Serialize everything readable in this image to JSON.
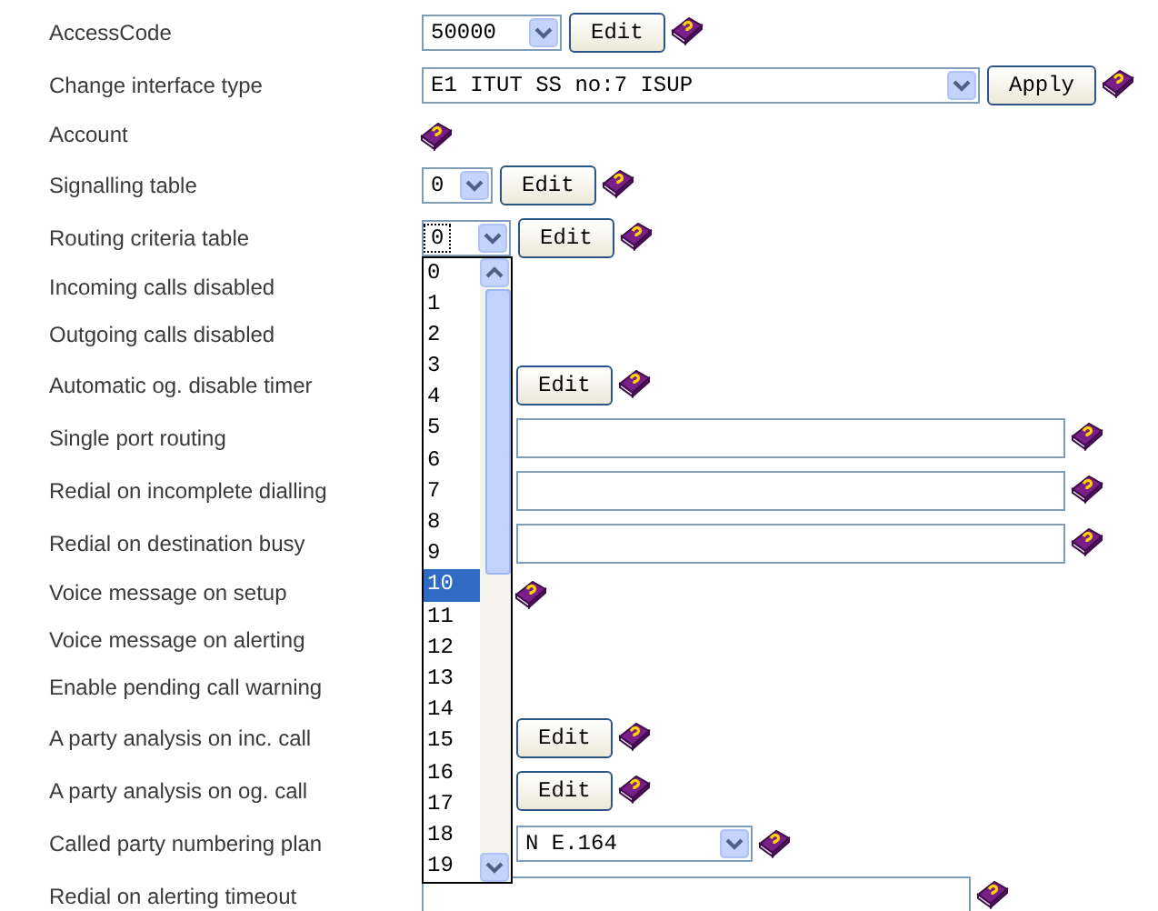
{
  "rows": [
    {
      "label": "AccessCode",
      "controls": [
        {
          "kind": "select",
          "value": "50000",
          "focused": false
        },
        {
          "kind": "button",
          "label": "Edit"
        },
        {
          "kind": "help"
        }
      ]
    },
    {
      "label": "Change interface type",
      "controls": [
        {
          "kind": "select",
          "value": "E1 ITUT SS no:7 ISUP",
          "focused": false
        },
        {
          "kind": "button",
          "label": "Apply"
        },
        {
          "kind": "help"
        }
      ]
    },
    {
      "label": "Account",
      "controls": [
        {
          "kind": "help"
        }
      ]
    },
    {
      "label": "Signalling table",
      "controls": [
        {
          "kind": "select",
          "value": "0",
          "focused": false
        },
        {
          "kind": "button",
          "label": "Edit"
        },
        {
          "kind": "help"
        }
      ]
    },
    {
      "label": "Routing criteria table",
      "controls": [
        {
          "kind": "select",
          "value": "0",
          "focused": true
        },
        {
          "kind": "button",
          "label": "Edit"
        },
        {
          "kind": "help"
        }
      ]
    },
    {
      "label": "Incoming calls disabled",
      "controls": []
    },
    {
      "label": "Outgoing calls disabled",
      "controls": []
    },
    {
      "label": "Automatic og. disable timer",
      "controls": [
        {
          "kind": "button",
          "label": "Edit"
        },
        {
          "kind": "help"
        }
      ]
    },
    {
      "label": "Single port routing",
      "controls": [
        {
          "kind": "input"
        },
        {
          "kind": "help"
        }
      ]
    },
    {
      "label": "Redial on incomplete dialling",
      "controls": [
        {
          "kind": "input"
        },
        {
          "kind": "help"
        }
      ]
    },
    {
      "label": "Redial on destination busy",
      "controls": [
        {
          "kind": "input"
        },
        {
          "kind": "help"
        }
      ]
    },
    {
      "label": "Voice message on setup",
      "controls": [
        {
          "kind": "help"
        }
      ]
    },
    {
      "label": "Voice message on alerting",
      "controls": []
    },
    {
      "label": "Enable pending call warning",
      "controls": []
    },
    {
      "label": "A party analysis on inc. call",
      "controls": [
        {
          "kind": "button",
          "label": "Edit"
        },
        {
          "kind": "help"
        }
      ]
    },
    {
      "label": "A party analysis on og. call",
      "controls": [
        {
          "kind": "button",
          "label": "Edit"
        },
        {
          "kind": "help"
        }
      ]
    },
    {
      "label": "Called party numbering plan",
      "controls": [
        {
          "kind": "select",
          "value": "N E.164",
          "focused": false
        },
        {
          "kind": "help"
        }
      ]
    },
    {
      "label": "Redial on alerting timeout",
      "controls": [
        {
          "kind": "input"
        },
        {
          "kind": "help"
        }
      ]
    }
  ],
  "dropdown": {
    "options": [
      {
        "label": "0",
        "selected": false
      },
      {
        "label": "1",
        "selected": false
      },
      {
        "label": "2",
        "selected": false
      },
      {
        "label": "3",
        "selected": false
      },
      {
        "label": "4",
        "selected": false
      },
      {
        "label": "5",
        "selected": false
      },
      {
        "label": "6",
        "selected": false
      },
      {
        "label": "7",
        "selected": false
      },
      {
        "label": "8",
        "selected": false
      },
      {
        "label": "9",
        "selected": false
      },
      {
        "label": "10",
        "selected": true
      },
      {
        "label": "11",
        "selected": false
      },
      {
        "label": "12",
        "selected": false
      },
      {
        "label": "13",
        "selected": false
      },
      {
        "label": "14",
        "selected": false
      },
      {
        "label": "15",
        "selected": false
      },
      {
        "label": "16",
        "selected": false
      },
      {
        "label": "17",
        "selected": false
      },
      {
        "label": "18",
        "selected": false
      },
      {
        "label": "19",
        "selected": false
      }
    ]
  }
}
